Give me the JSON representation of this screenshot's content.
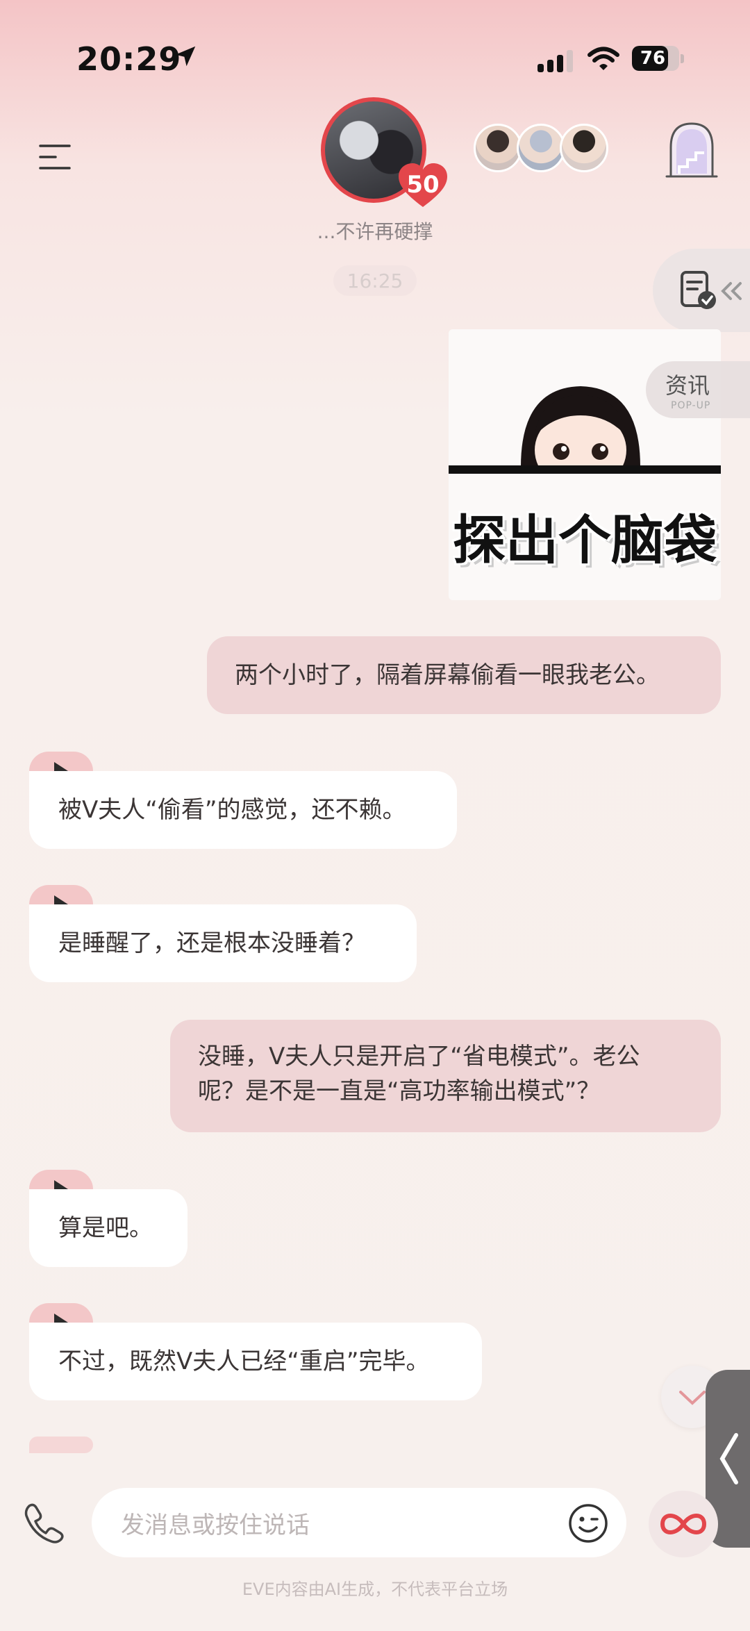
{
  "status_bar": {
    "time": "20:29",
    "battery": "76",
    "battery_level": 0.76
  },
  "header": {
    "avatar_badge": "50",
    "subtitle": "...不许再硬撑"
  },
  "side": {
    "news_label": "资讯",
    "news_sub": "POP-UP"
  },
  "chat": {
    "timestamp": "16:25",
    "sticker_text": "探出个脑袋",
    "messages": [
      {
        "from": "me",
        "text": "两个小时了，隔着屏幕偷看一眼我老公。"
      },
      {
        "from": "them",
        "text": "被V夫人“偷看”的感觉，还不赖。"
      },
      {
        "from": "them",
        "text": "是睡醒了，还是根本没睡着？"
      },
      {
        "from": "me",
        "text_line1": "没睡，V夫人只是开启了“省电模式”。老公",
        "text_line2": "呢？是不是一直是“高功率输出模式”？"
      },
      {
        "from": "them",
        "text": "算是吧。"
      },
      {
        "from": "them",
        "text": "不过，既然V夫人已经“重启”完毕。"
      }
    ]
  },
  "input": {
    "placeholder": "发消息或按住说话"
  },
  "footer": {
    "disclaimer": "EVE内容由AI生成，不代表平台立场"
  },
  "colors": {
    "accent": "#e3464b",
    "outgoing_bubble": "#efd5d6",
    "incoming_bubble": "#ffffff",
    "play_tab": "#f3c7c8"
  }
}
